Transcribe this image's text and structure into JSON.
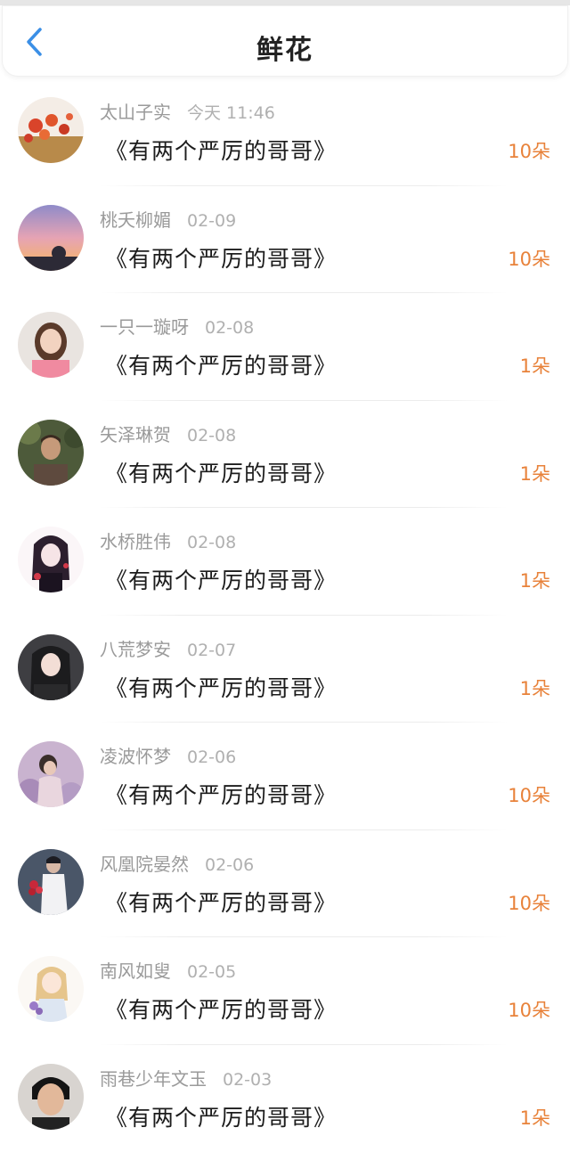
{
  "header": {
    "title": "鲜花",
    "back_icon": "chevron-left-icon",
    "accent": "#3b8fe6"
  },
  "colors": {
    "count": "#e8823a",
    "name": "#9a9a9a",
    "book": "#1c1c1c"
  },
  "items": [
    {
      "name": "太山子实",
      "date": "今天 11:46",
      "book": "《有两个严厉的哥哥》",
      "count": "10朵",
      "avatar": "avatar-flowers"
    },
    {
      "name": "桃夭柳媚",
      "date": "02-09",
      "book": "《有两个严厉的哥哥》",
      "count": "10朵",
      "avatar": "avatar-sunset"
    },
    {
      "name": "一只一璇呀",
      "date": "02-08",
      "book": "《有两个严厉的哥哥》",
      "count": "1朵",
      "avatar": "avatar-girl"
    },
    {
      "name": "矢泽琳贺",
      "date": "02-08",
      "book": "《有两个严厉的哥哥》",
      "count": "1朵",
      "avatar": "avatar-boy"
    },
    {
      "name": "水桥胜伟",
      "date": "02-08",
      "book": "《有两个严厉的哥哥》",
      "count": "1朵",
      "avatar": "avatar-anime-girl"
    },
    {
      "name": "八荒梦安",
      "date": "02-07",
      "book": "《有两个严厉的哥哥》",
      "count": "1朵",
      "avatar": "avatar-girl-dark"
    },
    {
      "name": "凌波怀梦",
      "date": "02-06",
      "book": "《有两个严厉的哥哥》",
      "count": "10朵",
      "avatar": "avatar-girl-purple"
    },
    {
      "name": "风凰院晏然",
      "date": "02-06",
      "book": "《有两个严厉的哥哥》",
      "count": "10朵",
      "avatar": "avatar-man-roses"
    },
    {
      "name": "南风如叟",
      "date": "02-05",
      "book": "《有两个严厉的哥哥》",
      "count": "10朵",
      "avatar": "avatar-anime-blonde"
    },
    {
      "name": "雨巷少年文玉",
      "date": "02-03",
      "book": "《有两个严厉的哥哥》",
      "count": "1朵",
      "avatar": "avatar-man-portrait"
    }
  ]
}
